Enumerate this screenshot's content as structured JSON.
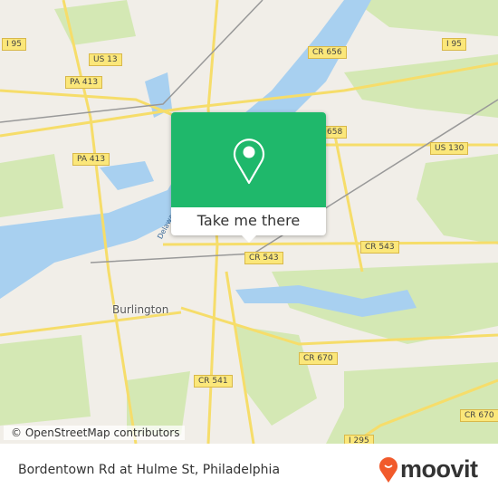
{
  "map": {
    "place_labels": [
      "Burlington"
    ],
    "river_label": "Delaware River",
    "road_shields": [
      "I 95",
      "US 13",
      "PA 413",
      "PA 413",
      "CR 656",
      "I 95",
      "658",
      "US 130",
      "CR 543",
      "CR 543",
      "CR 670",
      "CR 541",
      "CR 670",
      "I 295"
    ],
    "attribution": "© OpenStreetMap contributors",
    "colors": {
      "land": "#f1eee8",
      "water": "#a8d0f0",
      "park": "#d4e8b4",
      "road": "#f6dd6a",
      "popup": "#1fb86b"
    }
  },
  "popup": {
    "icon": "map-pin-icon",
    "button_label": "Take me there"
  },
  "footer": {
    "address": "Bordentown Rd at Hulme St, Philadelphia",
    "brand": "moovit",
    "brand_color": "#f15a2b"
  }
}
